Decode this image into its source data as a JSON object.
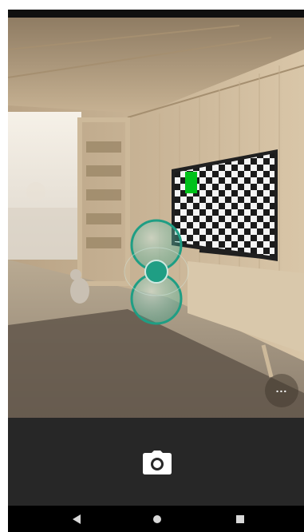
{
  "app": {
    "mode": "photosphere-capture"
  },
  "viewfinder": {
    "guide_color": "#1f9e84",
    "target_marker_color": "#00c21a"
  },
  "overflow_menu": {
    "label": "...",
    "icon": "more-horiz-icon"
  },
  "shutter": {
    "icon": "camera-icon"
  },
  "navigation": {
    "back_icon": "back-triangle-icon",
    "home_icon": "home-circle-icon",
    "recents_icon": "recents-square-icon"
  }
}
